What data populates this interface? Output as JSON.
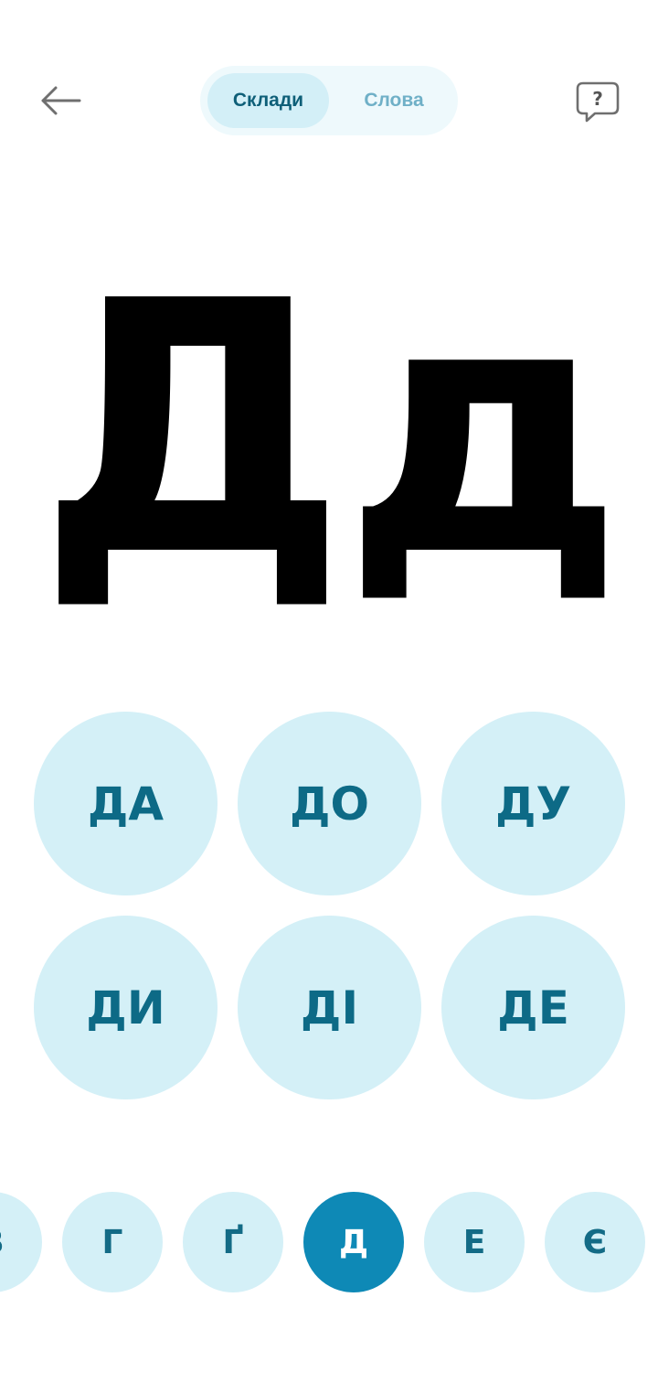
{
  "header": {
    "tabs": [
      {
        "label": "Склади",
        "active": true
      },
      {
        "label": "Слова",
        "active": false
      }
    ],
    "help_icon_text": "?",
    "back_icon": "arrow-left-icon",
    "help_icon": "speech-bubble-question-icon"
  },
  "letter": {
    "display": "Дд"
  },
  "syllables": [
    "ДА",
    "ДО",
    "ДУ",
    "ДИ",
    "ДІ",
    "ДЕ"
  ],
  "alphabet_strip": {
    "items": [
      "В",
      "Г",
      "Ґ",
      "Д",
      "Е",
      "Є"
    ],
    "selected": "Д"
  },
  "colors": {
    "accent": "#0e89b6",
    "bubble": "#d4f0f7",
    "syllable_text": "#0d6a86",
    "tab_active_text": "#0e5f78",
    "tab_inactive_text": "#6fb0c7"
  }
}
